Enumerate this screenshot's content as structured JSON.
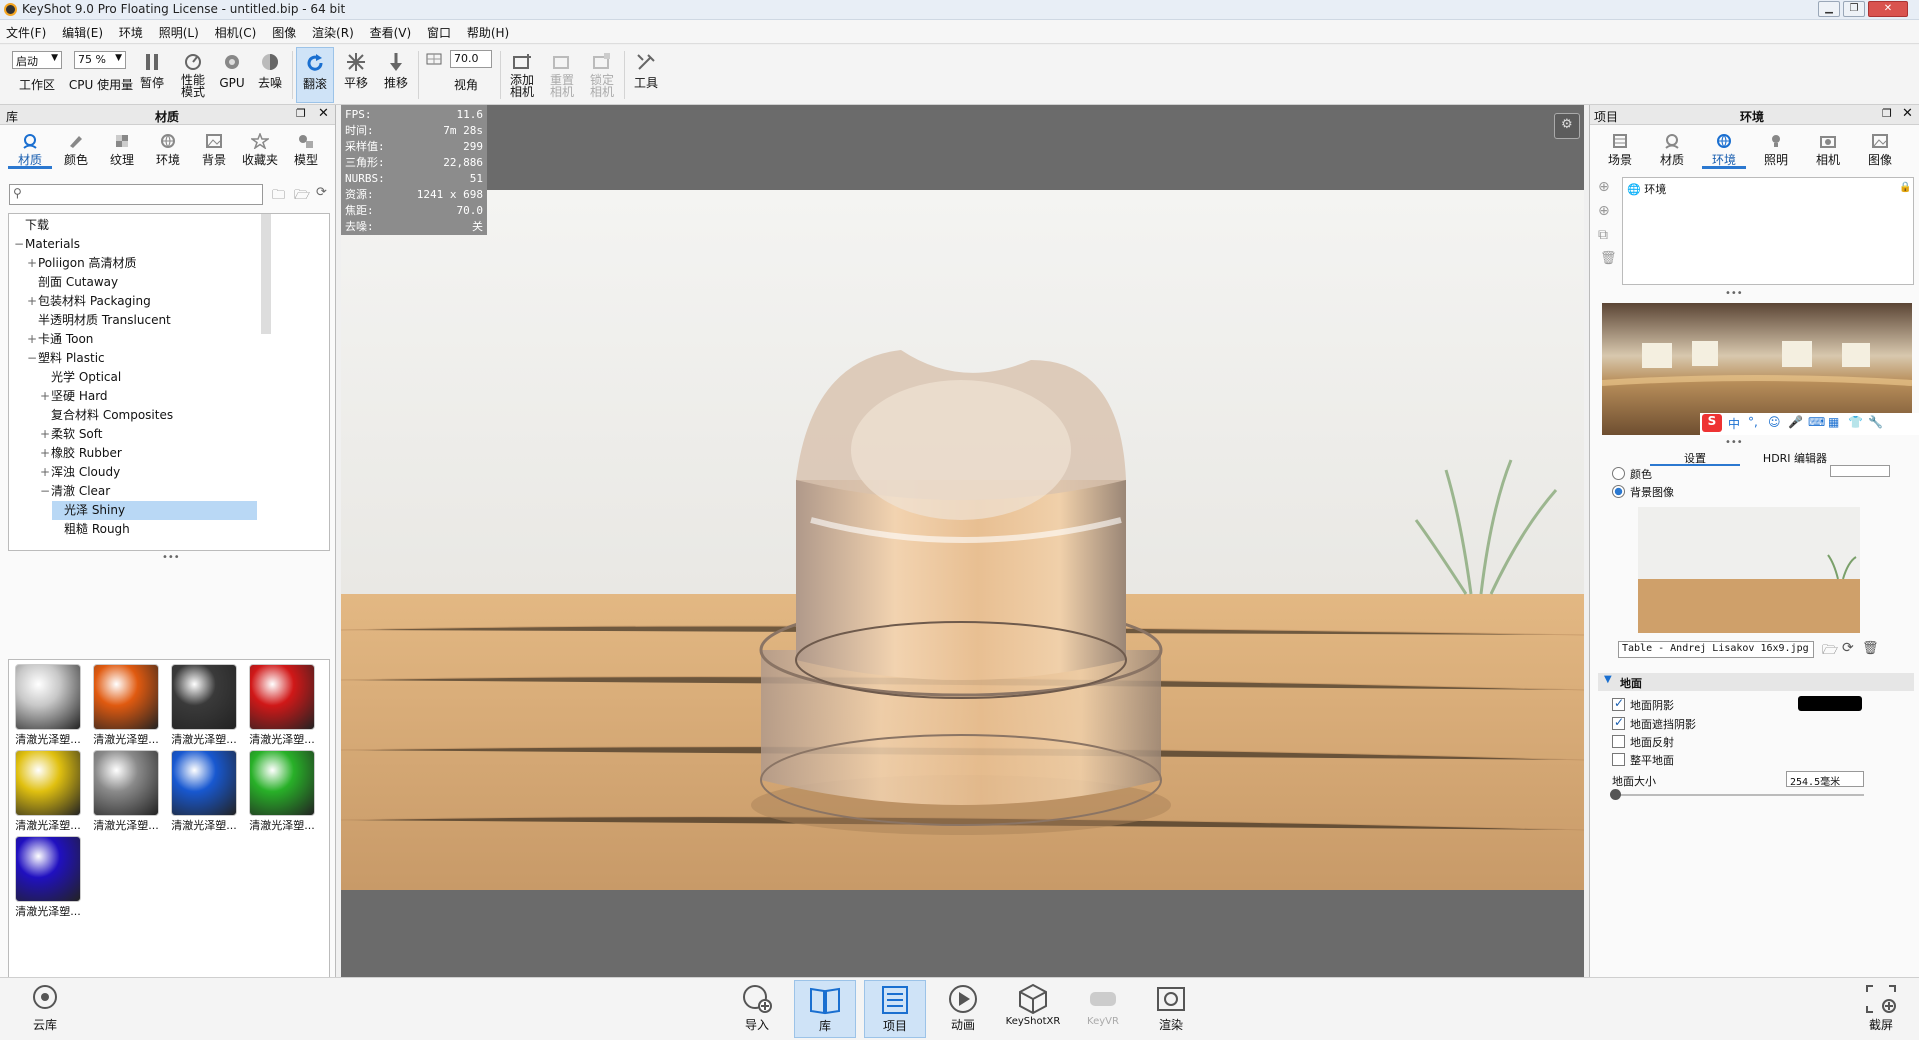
{
  "window": {
    "title": "KeyShot 9.0 Pro Floating License - untitled.bip - 64 bit"
  },
  "menu": [
    "文件(F)",
    "编辑(E)",
    "环境",
    "照明(L)",
    "相机(C)",
    "图像",
    "渲染(R)",
    "查看(V)",
    "窗口",
    "帮助(H)"
  ],
  "toolbar": {
    "workspace_value": "启动",
    "workspace_label": "工作区",
    "cpu_value": "75 %",
    "cpu_label": "CPU 使用量",
    "pause_label": "暂停",
    "perf_label": "性能\n模式",
    "gpu_label": "GPU",
    "denoise_label": "去噪",
    "tumble_label": "翻滚",
    "pan_label": "平移",
    "dolly_label": "推移",
    "fov_value": "70.0",
    "fov_label": "视角",
    "add_camera_label": "添加\n相机",
    "reset_camera_label": "重置\n相机",
    "lock_camera_label": "锁定\n相机",
    "tools_label": "工具"
  },
  "library": {
    "panel_left": "库",
    "panel_title": "材质",
    "tabs": [
      "材质",
      "颜色",
      "纹理",
      "环境",
      "背景",
      "收藏夹",
      "模型"
    ],
    "tree": [
      {
        "label": "下载",
        "indent": 0,
        "exp": ""
      },
      {
        "label": "Materials",
        "indent": 0,
        "exp": "−"
      },
      {
        "label": "Poliigon 高清材质",
        "indent": 1,
        "exp": "+"
      },
      {
        "label": "剖面 Cutaway",
        "indent": 1,
        "exp": ""
      },
      {
        "label": "包装材料 Packaging",
        "indent": 1,
        "exp": "+"
      },
      {
        "label": "半透明材质 Translucent",
        "indent": 1,
        "exp": ""
      },
      {
        "label": "卡通 Toon",
        "indent": 1,
        "exp": "+"
      },
      {
        "label": "塑料 Plastic",
        "indent": 1,
        "exp": "−"
      },
      {
        "label": "光学 Optical",
        "indent": 2,
        "exp": ""
      },
      {
        "label": "坚硬 Hard",
        "indent": 2,
        "exp": "+"
      },
      {
        "label": "复合材料 Composites",
        "indent": 2,
        "exp": ""
      },
      {
        "label": "柔软 Soft",
        "indent": 2,
        "exp": "+"
      },
      {
        "label": "橡胶 Rubber",
        "indent": 2,
        "exp": "+"
      },
      {
        "label": "浑浊 Cloudy",
        "indent": 2,
        "exp": "+"
      },
      {
        "label": "清澈 Clear",
        "indent": 2,
        "exp": "−"
      },
      {
        "label": "光泽 Shiny",
        "indent": 3,
        "exp": "",
        "selected": true
      },
      {
        "label": "粗糙 Rough",
        "indent": 3,
        "exp": ""
      }
    ],
    "thumbnails": [
      {
        "label": "清澈光泽塑...",
        "color": "#c8c8c8"
      },
      {
        "label": "清澈光泽塑...",
        "color": "#e05a10"
      },
      {
        "label": "清澈光泽塑...",
        "color": "#3a3a3a"
      },
      {
        "label": "清澈光泽塑...",
        "color": "#d01818"
      },
      {
        "label": "清澈光泽塑...",
        "color": "#e0c010"
      },
      {
        "label": "清澈光泽塑...",
        "color": "#8a8a8a"
      },
      {
        "label": "清澈光泽塑...",
        "color": "#1858d0"
      },
      {
        "label": "清澈光泽塑...",
        "color": "#28b028"
      },
      {
        "label": "清澈光泽塑...",
        "color": "#2010c0"
      }
    ]
  },
  "hud": [
    {
      "k": "FPS:",
      "v": "11.6"
    },
    {
      "k": "时间:",
      "v": "7m 28s"
    },
    {
      "k": "采样值:",
      "v": "299"
    },
    {
      "k": "三角形:",
      "v": "22,886"
    },
    {
      "k": "NURBS:",
      "v": "51"
    },
    {
      "k": "资源:",
      "v": "1241 x 698"
    },
    {
      "k": "焦距:",
      "v": "70.0"
    },
    {
      "k": "去噪:",
      "v": "关"
    }
  ],
  "project": {
    "panel_left": "项目",
    "panel_title": "环境",
    "tabs": [
      "场景",
      "材质",
      "环境",
      "照明",
      "相机",
      "图像"
    ],
    "env_item": "环境",
    "subtabs": [
      "设置",
      "HDRI 编辑器"
    ],
    "radio_color": "颜色",
    "radio_bg": "背景图像",
    "bg_file": "Table - Andrej Lisakov 16x9.jpg",
    "ground_section": "地面",
    "ground_shadow": "地面阴影",
    "ground_occlusion": "地面遮挡阴影",
    "ground_reflect": "地面反射",
    "flatten_ground": "整平地面",
    "ground_size_label": "地面大小",
    "ground_size_value": "254.5毫米",
    "ime_label": "中"
  },
  "bottom": {
    "cloud": "云库",
    "import": "导入",
    "library": "库",
    "project": "项目",
    "animation": "动画",
    "keyshotxr": "KeyShotXR",
    "keyvr": "KeyVR",
    "render": "渲染",
    "screenshot": "截屏"
  }
}
